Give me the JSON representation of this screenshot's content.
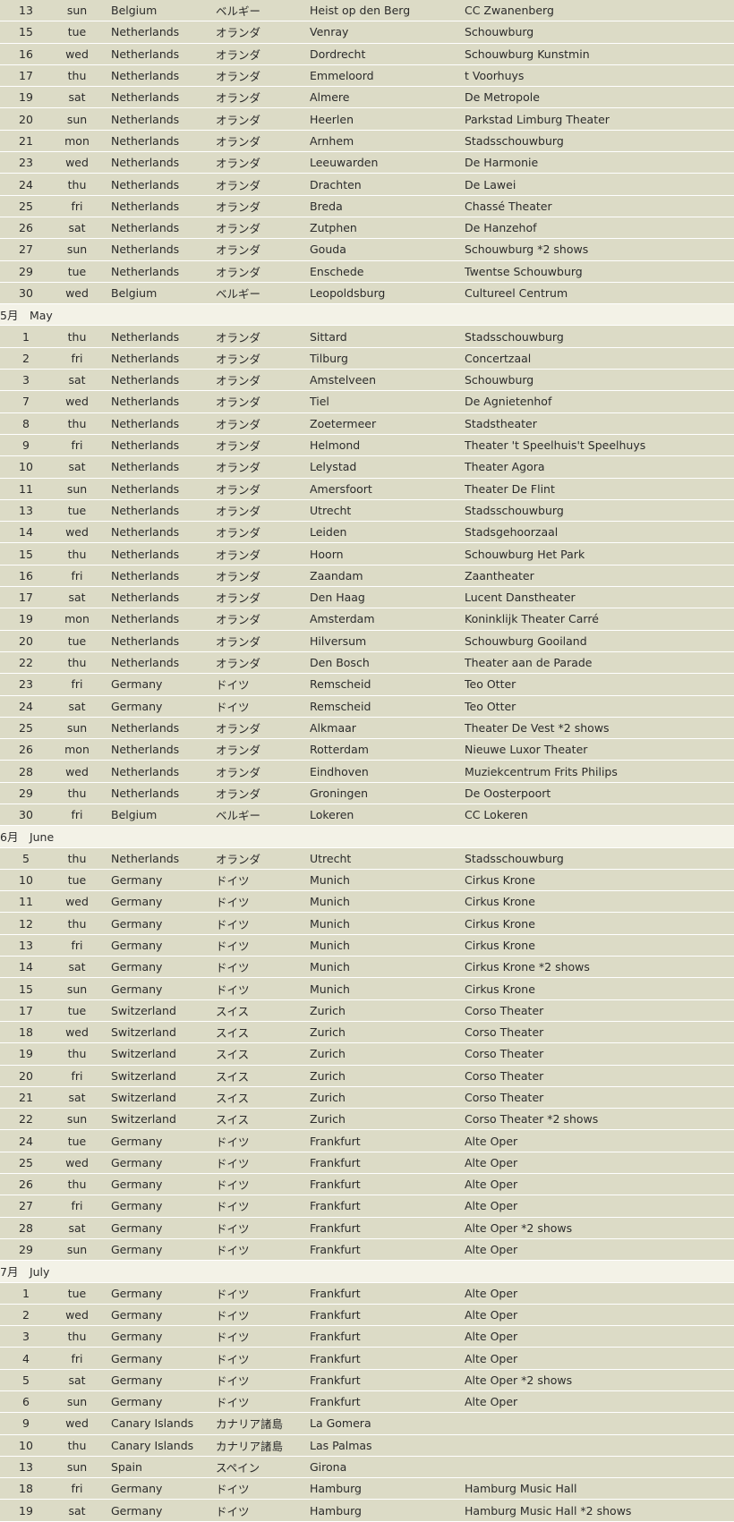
{
  "rows": [
    {
      "d": "13",
      "w": "sun",
      "c": "Belgium",
      "j": "ベルギー",
      "t": "Heist op den Berg",
      "v": "CC Zwanenberg"
    },
    {
      "d": "15",
      "w": "tue",
      "c": "Netherlands",
      "j": "オランダ",
      "t": "Venray",
      "v": "Schouwburg"
    },
    {
      "d": "16",
      "w": "wed",
      "c": "Netherlands",
      "j": "オランダ",
      "t": "Dordrecht",
      "v": "Schouwburg Kunstmin"
    },
    {
      "d": "17",
      "w": "thu",
      "c": "Netherlands",
      "j": "オランダ",
      "t": "Emmeloord",
      "v": "t Voorhuys"
    },
    {
      "d": "19",
      "w": "sat",
      "c": "Netherlands",
      "j": "オランダ",
      "t": "Almere",
      "v": "De Metropole"
    },
    {
      "d": "20",
      "w": "sun",
      "c": "Netherlands",
      "j": "オランダ",
      "t": "Heerlen",
      "v": "Parkstad Limburg Theater"
    },
    {
      "d": "21",
      "w": "mon",
      "c": "Netherlands",
      "j": "オランダ",
      "t": "Arnhem",
      "v": "Stadsschouwburg"
    },
    {
      "d": "23",
      "w": "wed",
      "c": "Netherlands",
      "j": "オランダ",
      "t": "Leeuwarden",
      "v": "De Harmonie"
    },
    {
      "d": "24",
      "w": "thu",
      "c": "Netherlands",
      "j": "オランダ",
      "t": "Drachten",
      "v": "De Lawei"
    },
    {
      "d": "25",
      "w": "fri",
      "c": "Netherlands",
      "j": "オランダ",
      "t": "Breda",
      "v": "Chassé Theater"
    },
    {
      "d": "26",
      "w": "sat",
      "c": "Netherlands",
      "j": "オランダ",
      "t": "Zutphen",
      "v": "De Hanzehof"
    },
    {
      "d": "27",
      "w": "sun",
      "c": "Netherlands",
      "j": "オランダ",
      "t": "Gouda",
      "v": "Schouwburg  *2 shows"
    },
    {
      "d": "29",
      "w": "tue",
      "c": "Netherlands",
      "j": "オランダ",
      "t": "Enschede",
      "v": "Twentse Schouwburg"
    },
    {
      "d": "30",
      "w": "wed",
      "c": "Belgium",
      "j": "ベルギー",
      "t": "Leopoldsburg",
      "v": "Cultureel Centrum"
    },
    {
      "month": "5月　May"
    },
    {
      "d": "1",
      "w": "thu",
      "c": "Netherlands",
      "j": "オランダ",
      "t": "Sittard",
      "v": "Stadsschouwburg"
    },
    {
      "d": "2",
      "w": "fri",
      "c": "Netherlands",
      "j": "オランダ",
      "t": "Tilburg",
      "v": "Concertzaal"
    },
    {
      "d": "3",
      "w": "sat",
      "c": "Netherlands",
      "j": "オランダ",
      "t": "Amstelveen",
      "v": "Schouwburg"
    },
    {
      "d": "7",
      "w": "wed",
      "c": "Netherlands",
      "j": "オランダ",
      "t": "Tiel",
      "v": "De Agnietenhof"
    },
    {
      "d": "8",
      "w": "thu",
      "c": "Netherlands",
      "j": "オランダ",
      "t": "Zoetermeer",
      "v": "Stadstheater"
    },
    {
      "d": "9",
      "w": "fri",
      "c": "Netherlands",
      "j": "オランダ",
      "t": "Helmond",
      "v": "Theater 't Speelhuis't Speelhuys"
    },
    {
      "d": "10",
      "w": "sat",
      "c": "Netherlands",
      "j": "オランダ",
      "t": "Lelystad",
      "v": "Theater Agora"
    },
    {
      "d": "11",
      "w": "sun",
      "c": "Netherlands",
      "j": "オランダ",
      "t": "Amersfoort",
      "v": "Theater De Flint"
    },
    {
      "d": "13",
      "w": "tue",
      "c": "Netherlands",
      "j": "オランダ",
      "t": "Utrecht",
      "v": "Stadsschouwburg"
    },
    {
      "d": "14",
      "w": "wed",
      "c": "Netherlands",
      "j": "オランダ",
      "t": "Leiden",
      "v": "Stadsgehoorzaal"
    },
    {
      "d": "15",
      "w": "thu",
      "c": "Netherlands",
      "j": "オランダ",
      "t": "Hoorn",
      "v": "Schouwburg Het Park"
    },
    {
      "d": "16",
      "w": "fri",
      "c": "Netherlands",
      "j": "オランダ",
      "t": "Zaandam",
      "v": "Zaantheater"
    },
    {
      "d": "17",
      "w": "sat",
      "c": "Netherlands",
      "j": "オランダ",
      "t": "Den Haag",
      "v": "Lucent Danstheater"
    },
    {
      "d": "19",
      "w": "mon",
      "c": "Netherlands",
      "j": "オランダ",
      "t": "Amsterdam",
      "v": "Koninklijk Theater Carré"
    },
    {
      "d": "20",
      "w": "tue",
      "c": "Netherlands",
      "j": "オランダ",
      "t": "Hilversum",
      "v": "Schouwburg Gooiland"
    },
    {
      "d": "22",
      "w": "thu",
      "c": "Netherlands",
      "j": "オランダ",
      "t": "Den Bosch",
      "v": "Theater aan de Parade"
    },
    {
      "d": "23",
      "w": "fri",
      "c": "Germany",
      "j": "ドイツ",
      "t": "Remscheid",
      "v": "Teo Otter"
    },
    {
      "d": "24",
      "w": "sat",
      "c": "Germany",
      "j": "ドイツ",
      "t": "Remscheid",
      "v": "Teo Otter"
    },
    {
      "d": "25",
      "w": "sun",
      "c": "Netherlands",
      "j": "オランダ",
      "t": "Alkmaar",
      "v": "Theater De Vest  *2 shows"
    },
    {
      "d": "26",
      "w": "mon",
      "c": "Netherlands",
      "j": "オランダ",
      "t": "Rotterdam",
      "v": "Nieuwe Luxor Theater"
    },
    {
      "d": "28",
      "w": "wed",
      "c": "Netherlands",
      "j": "オランダ",
      "t": "Eindhoven",
      "v": "Muziekcentrum Frits Philips"
    },
    {
      "d": "29",
      "w": "thu",
      "c": "Netherlands",
      "j": "オランダ",
      "t": "Groningen",
      "v": "De Oosterpoort"
    },
    {
      "d": "30",
      "w": "fri",
      "c": "Belgium",
      "j": "ベルギー",
      "t": "Lokeren",
      "v": "CC Lokeren"
    },
    {
      "month": "6月　June"
    },
    {
      "d": "5",
      "w": "thu",
      "c": "Netherlands",
      "j": "オランダ",
      "t": "Utrecht",
      "v": "Stadsschouwburg"
    },
    {
      "d": "10",
      "w": "tue",
      "c": "Germany",
      "j": "ドイツ",
      "t": "Munich",
      "v": "Cirkus Krone"
    },
    {
      "d": "11",
      "w": "wed",
      "c": "Germany",
      "j": "ドイツ",
      "t": "Munich",
      "v": "Cirkus Krone"
    },
    {
      "d": "12",
      "w": "thu",
      "c": "Germany",
      "j": "ドイツ",
      "t": "Munich",
      "v": "Cirkus Krone"
    },
    {
      "d": "13",
      "w": "fri",
      "c": "Germany",
      "j": "ドイツ",
      "t": "Munich",
      "v": "Cirkus Krone"
    },
    {
      "d": "14",
      "w": "sat",
      "c": "Germany",
      "j": "ドイツ",
      "t": "Munich",
      "v": "Cirkus Krone  *2 shows"
    },
    {
      "d": "15",
      "w": "sun",
      "c": "Germany",
      "j": "ドイツ",
      "t": "Munich",
      "v": "Cirkus Krone"
    },
    {
      "d": "17",
      "w": "tue",
      "c": "Switzerland",
      "j": "スイス",
      "t": "Zurich",
      "v": "Corso Theater"
    },
    {
      "d": "18",
      "w": "wed",
      "c": "Switzerland",
      "j": "スイス",
      "t": "Zurich",
      "v": "Corso Theater"
    },
    {
      "d": "19",
      "w": "thu",
      "c": "Switzerland",
      "j": "スイス",
      "t": "Zurich",
      "v": "Corso Theater"
    },
    {
      "d": "20",
      "w": "fri",
      "c": "Switzerland",
      "j": "スイス",
      "t": "Zurich",
      "v": "Corso Theater"
    },
    {
      "d": "21",
      "w": "sat",
      "c": "Switzerland",
      "j": "スイス",
      "t": "Zurich",
      "v": "Corso Theater"
    },
    {
      "d": "22",
      "w": "sun",
      "c": "Switzerland",
      "j": "スイス",
      "t": "Zurich",
      "v": "Corso Theater  *2 shows"
    },
    {
      "d": "24",
      "w": "tue",
      "c": "Germany",
      "j": "ドイツ",
      "t": "Frankfurt",
      "v": "Alte Oper"
    },
    {
      "d": "25",
      "w": "wed",
      "c": "Germany",
      "j": "ドイツ",
      "t": "Frankfurt",
      "v": "Alte Oper"
    },
    {
      "d": "26",
      "w": "thu",
      "c": "Germany",
      "j": "ドイツ",
      "t": "Frankfurt",
      "v": "Alte Oper"
    },
    {
      "d": "27",
      "w": "fri",
      "c": "Germany",
      "j": "ドイツ",
      "t": "Frankfurt",
      "v": "Alte Oper"
    },
    {
      "d": "28",
      "w": "sat",
      "c": "Germany",
      "j": "ドイツ",
      "t": "Frankfurt",
      "v": "Alte Oper  *2 shows"
    },
    {
      "d": "29",
      "w": "sun",
      "c": "Germany",
      "j": "ドイツ",
      "t": "Frankfurt",
      "v": "Alte Oper"
    },
    {
      "month": "7月　July"
    },
    {
      "d": "1",
      "w": "tue",
      "c": "Germany",
      "j": "ドイツ",
      "t": "Frankfurt",
      "v": "Alte Oper"
    },
    {
      "d": "2",
      "w": "wed",
      "c": "Germany",
      "j": "ドイツ",
      "t": "Frankfurt",
      "v": "Alte Oper"
    },
    {
      "d": "3",
      "w": "thu",
      "c": "Germany",
      "j": "ドイツ",
      "t": "Frankfurt",
      "v": "Alte Oper"
    },
    {
      "d": "4",
      "w": "fri",
      "c": "Germany",
      "j": "ドイツ",
      "t": "Frankfurt",
      "v": "Alte Oper"
    },
    {
      "d": "5",
      "w": "sat",
      "c": "Germany",
      "j": "ドイツ",
      "t": "Frankfurt",
      "v": "Alte Oper  *2 shows"
    },
    {
      "d": "6",
      "w": "sun",
      "c": "Germany",
      "j": "ドイツ",
      "t": "Frankfurt",
      "v": "Alte Oper"
    },
    {
      "d": "9",
      "w": "wed",
      "c": "Canary Islands",
      "j": "カナリア諸島",
      "t": "La Gomera",
      "v": ""
    },
    {
      "d": "10",
      "w": "thu",
      "c": "Canary Islands",
      "j": "カナリア諸島",
      "t": "Las Palmas",
      "v": ""
    },
    {
      "d": "13",
      "w": "sun",
      "c": "Spain",
      "j": "スペイン",
      "t": "Girona",
      "v": ""
    },
    {
      "d": "18",
      "w": "fri",
      "c": "Germany",
      "j": "ドイツ",
      "t": "Hamburg",
      "v": "Hamburg Music Hall"
    },
    {
      "d": "19",
      "w": "sat",
      "c": "Germany",
      "j": "ドイツ",
      "t": "Hamburg",
      "v": "Hamburg Music Hall  *2 shows"
    }
  ]
}
